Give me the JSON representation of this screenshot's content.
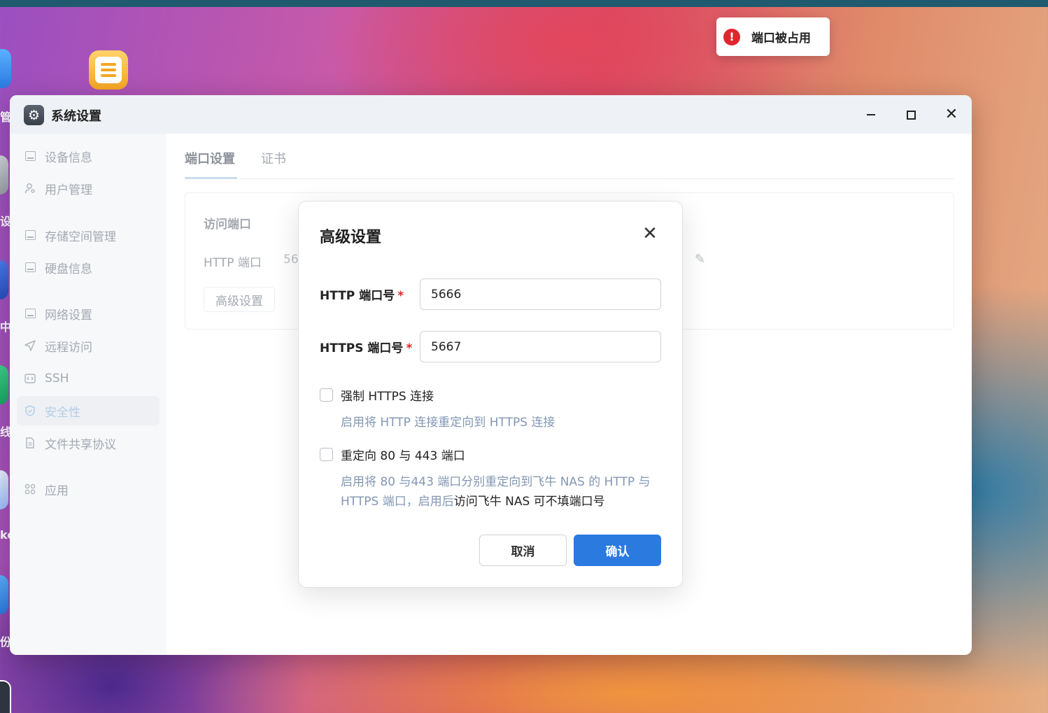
{
  "toast": {
    "icon": "error-icon",
    "text": "端口被占用",
    "color": "#e0262d"
  },
  "desktop": {
    "labels": [
      "管理",
      "设置",
      "中心",
      "线",
      "ker",
      "份"
    ]
  },
  "window": {
    "title": "系统设置",
    "app_icon": "gear-icon",
    "controls": {
      "minimize": "minimize-icon",
      "maximize": "maximize-icon",
      "close": "close-icon"
    }
  },
  "sidebar": {
    "items": [
      {
        "label": "设备信息",
        "icon": "device-icon"
      },
      {
        "label": "用户管理",
        "icon": "user-icon"
      },
      {
        "label": "存储空间管理",
        "icon": "storage-icon"
      },
      {
        "label": "硬盘信息",
        "icon": "disk-icon"
      },
      {
        "label": "网络设置",
        "icon": "network-icon"
      },
      {
        "label": "远程访问",
        "icon": "send-icon"
      },
      {
        "label": "SSH",
        "icon": "code-icon"
      },
      {
        "label": "安全性",
        "icon": "shield-icon",
        "active": true
      },
      {
        "label": "文件共享协议",
        "icon": "file-icon"
      },
      {
        "label": "应用",
        "icon": "apps-icon"
      }
    ]
  },
  "tabs": [
    {
      "label": "端口设置",
      "active": true
    },
    {
      "label": "证书",
      "active": false
    }
  ],
  "card": {
    "title": "访问端口",
    "http_label": "HTTP 端口",
    "http_value": "56",
    "advanced_button": "高级设置"
  },
  "modal": {
    "title": "高级设置",
    "http_label": "HTTP 端口号",
    "http_value": "5666",
    "https_label": "HTTPS 端口号",
    "https_value": "5667",
    "required_mark": "*",
    "force_https": {
      "label": "强制 HTTPS 连接",
      "checked": false,
      "hint": "启用将 HTTP 连接重定向到 HTTPS 连接"
    },
    "redirect_ports": {
      "label": "重定向 80 与 443 端口",
      "checked": false,
      "hint_line1": "启用将 80 与443 端口分别重定向到飞牛 NAS 的 HTTP 与",
      "hint_line2_a": "HTTPS 端口，启用后",
      "hint_line2_b": "访问飞牛 NAS 可不填端口号"
    },
    "cancel_label": "取消",
    "confirm_label": "确认",
    "accent": "#2b7ae0"
  }
}
